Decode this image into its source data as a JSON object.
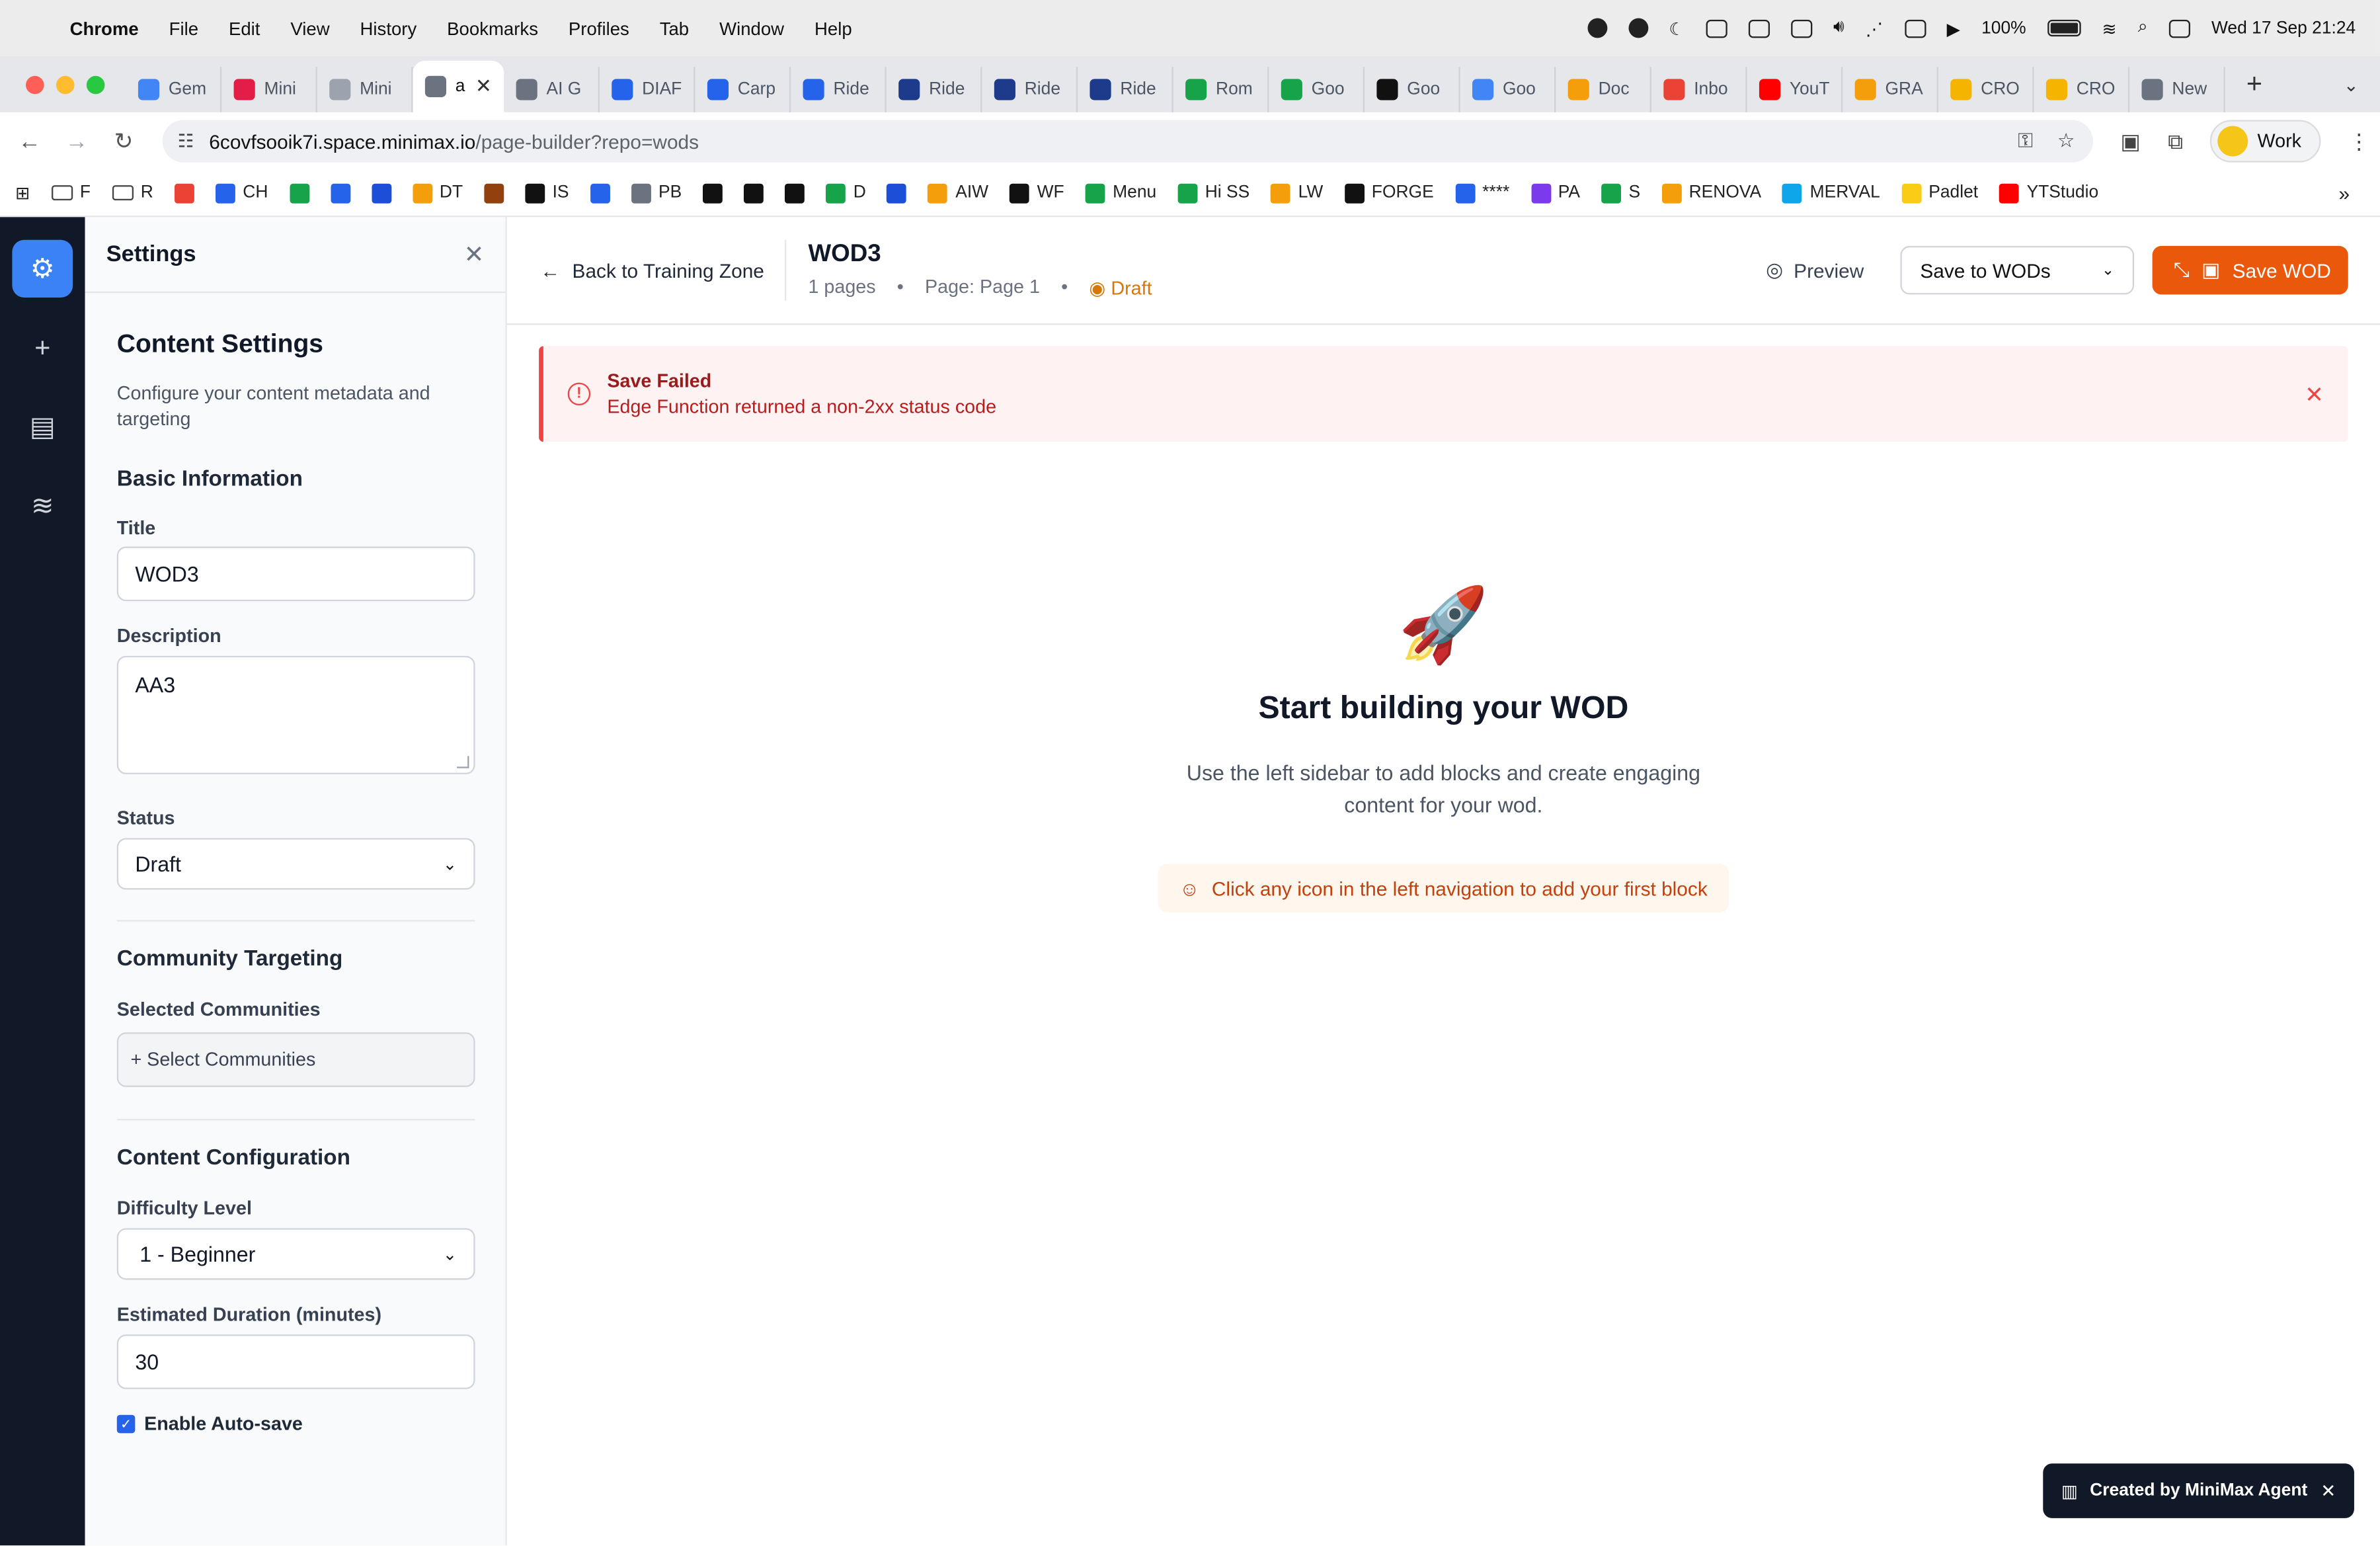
{
  "menubar": {
    "app": "Chrome",
    "items": [
      "File",
      "Edit",
      "View",
      "History",
      "Bookmarks",
      "Profiles",
      "Tab",
      "Window",
      "Help"
    ],
    "battery": "100%",
    "datetime": "Wed 17 Sep  21:24"
  },
  "tabs": [
    {
      "label": "Gem",
      "color": "#4285f4"
    },
    {
      "label": "Mini",
      "color": "#e11d48"
    },
    {
      "label": "Mini",
      "color": "#9ca3af"
    },
    {
      "label": "a",
      "color": "#6b7280",
      "active": true
    },
    {
      "label": "AI G",
      "color": "#6b7280"
    },
    {
      "label": "DIAF",
      "color": "#2563eb"
    },
    {
      "label": "Carp",
      "color": "#2563eb"
    },
    {
      "label": "Ride",
      "color": "#2563eb"
    },
    {
      "label": "Ride",
      "color": "#1e3a8a"
    },
    {
      "label": "Ride",
      "color": "#1e3a8a"
    },
    {
      "label": "Ride",
      "color": "#1e3a8a"
    },
    {
      "label": "Rom",
      "color": "#16a34a"
    },
    {
      "label": "Goo",
      "color": "#16a34a"
    },
    {
      "label": "Goo",
      "color": "#111111"
    },
    {
      "label": "Goo",
      "color": "#4285f4"
    },
    {
      "label": "Doc",
      "color": "#f59e0b"
    },
    {
      "label": "Inbo",
      "color": "#ea4335"
    },
    {
      "label": "YouT",
      "color": "#ff0000"
    },
    {
      "label": "GRA",
      "color": "#f59e0b"
    },
    {
      "label": "CRO",
      "color": "#f5b400"
    },
    {
      "label": "CRO",
      "color": "#f5b400"
    },
    {
      "label": "New",
      "color": "#6b7280"
    }
  ],
  "address": {
    "host": "6covfsooik7i.space.minimax.io",
    "path": "/page-builder?repo=wods",
    "profile": "Work"
  },
  "bookmarks": [
    {
      "label": "F",
      "color": "folder"
    },
    {
      "label": "R",
      "color": "folder"
    },
    {
      "label": "",
      "color": "#ea4335"
    },
    {
      "label": "CH",
      "color": "#2563eb"
    },
    {
      "label": "",
      "color": "#16a34a"
    },
    {
      "label": "",
      "color": "#2563eb"
    },
    {
      "label": "",
      "color": "#1d4ed8"
    },
    {
      "label": "DT",
      "color": "#f59e0b"
    },
    {
      "label": "",
      "color": "#92400e"
    },
    {
      "label": "IS",
      "color": "#111111"
    },
    {
      "label": "",
      "color": "#2563eb"
    },
    {
      "label": "PB",
      "color": "#6b7280"
    },
    {
      "label": "",
      "color": "#111111"
    },
    {
      "label": "",
      "color": "#111111"
    },
    {
      "label": "",
      "color": "#111111"
    },
    {
      "label": "D",
      "color": "#16a34a"
    },
    {
      "label": "",
      "color": "#1d4ed8"
    },
    {
      "label": "AIW",
      "color": "#f59e0b"
    },
    {
      "label": "WF",
      "color": "#111111"
    },
    {
      "label": "Menu",
      "color": "#16a34a"
    },
    {
      "label": "Hi SS",
      "color": "#16a34a"
    },
    {
      "label": "LW",
      "color": "#f59e0b"
    },
    {
      "label": "FORGE",
      "color": "#111111"
    },
    {
      "label": "****",
      "color": "#2563eb"
    },
    {
      "label": "PA",
      "color": "#7c3aed"
    },
    {
      "label": "S",
      "color": "#16a34a"
    },
    {
      "label": "RENOVA",
      "color": "#f59e0b"
    },
    {
      "label": "MERVAL",
      "color": "#0ea5e9"
    },
    {
      "label": "Padlet",
      "color": "#facc15"
    },
    {
      "label": "YTStudio",
      "color": "#ff0000"
    }
  ],
  "settings": {
    "panel_title": "Settings",
    "heading": "Content Settings",
    "subtitle": "Configure your content metadata and targeting",
    "basic_info": "Basic Information",
    "title_label": "Title",
    "title_value": "WOD3",
    "description_label": "Description",
    "description_value": "AA3",
    "status_label": "Status",
    "status_value": "Draft",
    "community_heading": "Community Targeting",
    "selected_communities_label": "Selected Communities",
    "select_communities": "+ Select Communities",
    "config_heading": "Content Configuration",
    "difficulty_label": "Difficulty Level",
    "difficulty_value": "1 - Beginner",
    "duration_label": "Estimated Duration (minutes)",
    "duration_value": "30",
    "autosave_label": "Enable Auto-save",
    "autosave_checked": true
  },
  "header": {
    "back": "Back to Training Zone",
    "title": "WOD3",
    "pages": "1 pages",
    "page": "Page: Page 1",
    "status": "Draft",
    "preview": "Preview",
    "save_target": "Save to WODs",
    "save_button": "Save WOD"
  },
  "alert": {
    "title": "Save Failed",
    "message": "Edge Function returned a non-2xx status code"
  },
  "empty_state": {
    "icon": "🚀",
    "heading": "Start building your WOD",
    "body": "Use the left sidebar to add blocks and create engaging content for your wod.",
    "hint": "Click any icon in the left navigation to add your first block"
  },
  "toast": {
    "label": "Created by MiniMax Agent"
  },
  "colors": {
    "rail": "#111827",
    "accent_blue": "#3b82f6",
    "save_orange": "#ea580c",
    "error_red": "#ef4444",
    "draft_amber": "#d97706"
  }
}
